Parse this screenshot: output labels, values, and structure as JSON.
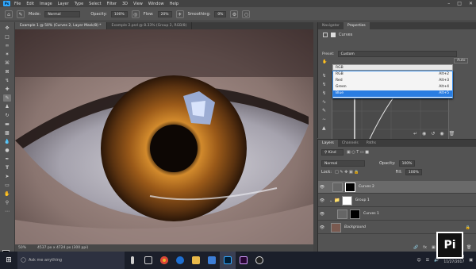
{
  "app": {
    "logo": "Ps"
  },
  "menu": [
    "File",
    "Edit",
    "Image",
    "Layer",
    "Type",
    "Select",
    "Filter",
    "3D",
    "View",
    "Window",
    "Help"
  ],
  "options": {
    "mode_label": "Mode:",
    "mode_value": "Normal",
    "opacity_label": "Opacity:",
    "opacity_value": "100%",
    "flow_label": "Flow:",
    "flow_value": "20%",
    "smoothing_label": "Smoothing:",
    "smoothing_value": "0%"
  },
  "tabs": [
    "Example 1 @ 50% (Curves 2, Layer Mask/8) *",
    "Example 2.psd @ 8.33% (Group 2, RGB/8)"
  ],
  "status": {
    "zoom": "50%",
    "doc": "4537 px x 4724 px (300 ppi)"
  },
  "properties": {
    "tabs": [
      "Navigator",
      "Properties"
    ],
    "title": "Curves",
    "preset_label": "Preset:",
    "preset_value": "Custom",
    "channel_value": "RGB",
    "auto_label": "Auto",
    "channels": [
      {
        "name": "RGB",
        "shortcut": "Alt+2"
      },
      {
        "name": "Red",
        "shortcut": "Alt+3"
      },
      {
        "name": "Green",
        "shortcut": "Alt+4"
      },
      {
        "name": "Blue",
        "shortcut": "Alt+5"
      }
    ]
  },
  "layers": {
    "tabs": [
      "Layers",
      "Channels",
      "Paths"
    ],
    "kind_label": "Kind",
    "blend_value": "Normal",
    "opacity_label": "Opacity:",
    "opacity_value": "100%",
    "lock_label": "Lock:",
    "fill_label": "Fill:",
    "fill_value": "100%",
    "rows": [
      {
        "name": "Curves 2"
      },
      {
        "name": "Group 1"
      },
      {
        "name": "Curves 1"
      },
      {
        "name": "Background"
      }
    ]
  },
  "taskbar": {
    "search_placeholder": "Ask me anything",
    "time": "2:16 PM",
    "date": "11/27/2017"
  },
  "watermark": "Pi",
  "colors": {
    "accent": "#31a8ff",
    "selection": "#2a7de1",
    "taskbar": "#1b1f2a"
  },
  "icons": [
    "home-icon",
    "brush-icon",
    "move-icon",
    "marquee-icon",
    "lasso-icon",
    "crop-icon",
    "eyedropper-icon",
    "healing-icon",
    "stamp-icon",
    "eraser-icon",
    "gradient-icon",
    "dodge-icon",
    "pen-icon",
    "text-icon",
    "path-select-icon",
    "shape-icon",
    "hand-icon",
    "zoom-icon",
    "eye-icon",
    "search-icon",
    "windows-icon"
  ]
}
